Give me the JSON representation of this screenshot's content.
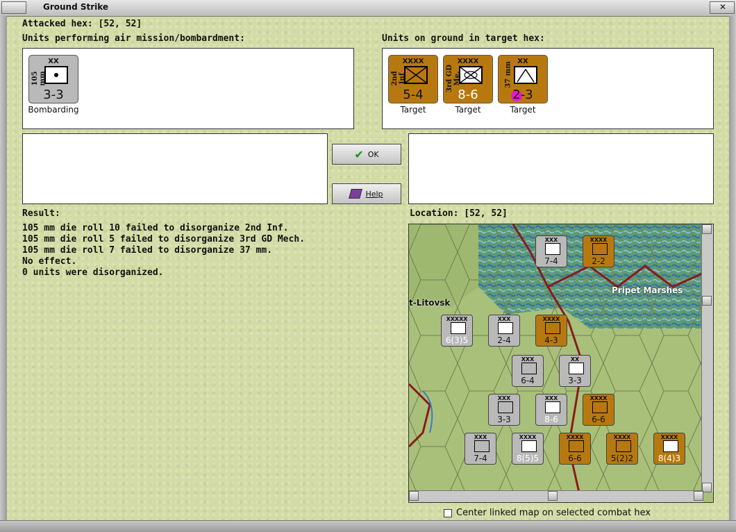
{
  "window": {
    "title": "Ground Strike"
  },
  "header": {
    "attacked_hex": "Attacked hex:  [52, 52]"
  },
  "air_panel": {
    "label": "Units performing air mission/bombardment:",
    "units": [
      {
        "size": "XX",
        "side": "105 mm",
        "strength": "3-3",
        "caption": "Bombarding",
        "color": "#b9b9b9"
      }
    ]
  },
  "ground_panel": {
    "label": "Units on ground in target hex:",
    "units": [
      {
        "size": "XXXX",
        "side": "2nd Inf",
        "strength": "5-4",
        "caption": "Target",
        "color": "#b7790f"
      },
      {
        "size": "XXXX",
        "side": "3rd GD Me.",
        "strength": "8-6",
        "caption": "Target",
        "color": "#b7790f"
      },
      {
        "size": "XX",
        "side": "37 mm",
        "strength": "2-3",
        "caption": "Target",
        "color": "#b7790f"
      }
    ]
  },
  "buttons": {
    "ok": "OK",
    "help": "Help"
  },
  "result": {
    "label": "Result:",
    "lines": [
      "105 mm die roll 10 failed to disorganize 2nd Inf.",
      "105 mm die roll 5 failed to disorganize 3rd GD Mech.",
      "105 mm die roll 7 failed to disorganize 37 mm.",
      "No effect.",
      "0 units were disorganized."
    ]
  },
  "location": {
    "label": "Location:  [52, 52]"
  },
  "map": {
    "labels": [
      "Pripet Marshes",
      "t-Litovsk"
    ],
    "counters": [
      {
        "size": "XXX",
        "value": "7-4",
        "color": "#b9b9b9"
      },
      {
        "size": "XXXX",
        "value": "2-2",
        "color": "#b7790f"
      },
      {
        "size": "XXXXX",
        "value": "6(3)5",
        "color": "#b9b9b9"
      },
      {
        "size": "XXX",
        "value": "2-4",
        "color": "#b9b9b9"
      },
      {
        "size": "XXXX",
        "value": "4-3",
        "color": "#b7790f"
      },
      {
        "size": "XXX",
        "value": "6-4",
        "color": "#b9b9b9"
      },
      {
        "size": "XX",
        "value": "3-3",
        "color": "#b9b9b9"
      },
      {
        "size": "XXX",
        "value": "3-3",
        "color": "#b9b9b9"
      },
      {
        "size": "XXX",
        "value": "8-6",
        "color": "#b9b9b9"
      },
      {
        "size": "XXXX",
        "value": "6-6",
        "color": "#b7790f"
      },
      {
        "size": "XXX",
        "value": "7-4",
        "color": "#b9b9b9"
      },
      {
        "size": "XXXX",
        "value": "8(5)5",
        "color": "#b9b9b9"
      },
      {
        "size": "XXXX",
        "value": "6-6",
        "color": "#b7790f"
      },
      {
        "size": "XXXX",
        "value": "5(2)2",
        "color": "#b7790f"
      },
      {
        "size": "XXXX",
        "value": "8(4)3",
        "color": "#b7790f"
      }
    ]
  },
  "checkbox": {
    "label": "Center linked map on selected combat hex"
  }
}
